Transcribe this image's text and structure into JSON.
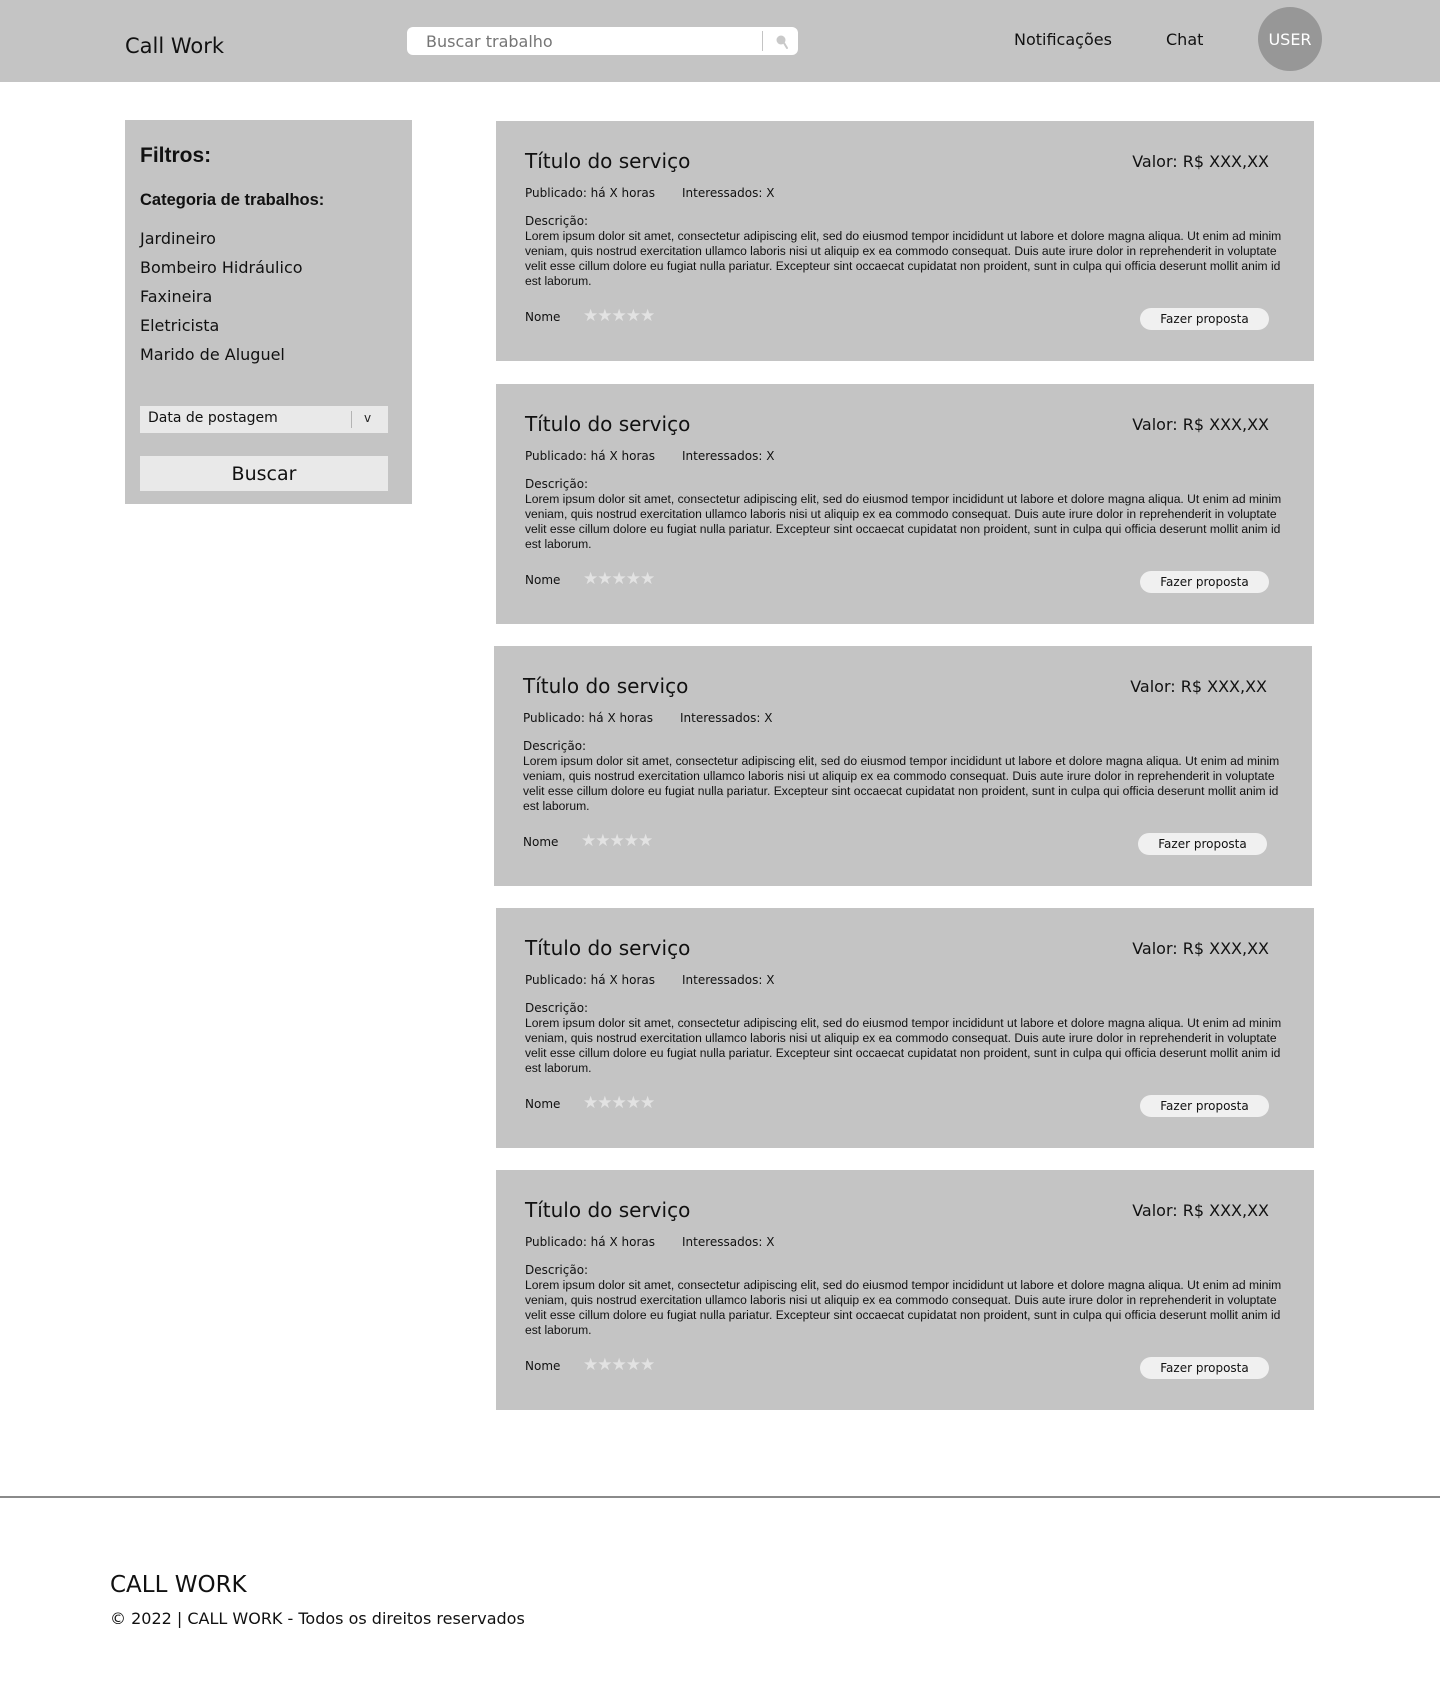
{
  "header": {
    "logo": "Call Work",
    "search_placeholder": "Buscar trabalho",
    "nav": {
      "notifications": "Notificações",
      "chat": "Chat"
    },
    "user_label": "USER"
  },
  "sidebar": {
    "title": "Filtros:",
    "category_title": "Categoria de trabalhos:",
    "categories": [
      "Jardineiro",
      "Bombeiro Hidráulico",
      "Faxineira",
      "Eletricista",
      "Marido de Aluguel"
    ],
    "sort_select": "Data de postagem",
    "sort_arrow": "v",
    "search_button": "Buscar"
  },
  "jobs": [
    {
      "title": "Título do serviço",
      "value": "Valor: R$ XXX,XX",
      "published": "Publicado: há X horas",
      "interested": "Interessados: X",
      "description_label": "Descrição:",
      "description": "Lorem ipsum dolor sit amet, consectetur adipiscing elit, sed do eiusmod tempor incididunt ut labore et dolore magna aliqua. Ut enim ad minim veniam, quis nostrud exercitation ullamco laboris nisi ut aliquip ex ea commodo consequat. Duis aute irure dolor in reprehenderit in voluptate velit esse cillum dolore eu fugiat nulla pariatur. Excepteur sint occaecat cupidatat non proident, sunt in culpa qui officia deserunt mollit anim id est laborum.",
      "name": "Nome",
      "stars": "★★★★★",
      "button": "Fazer proposta"
    },
    {
      "title": "Título do serviço",
      "value": "Valor: R$ XXX,XX",
      "published": "Publicado: há X horas",
      "interested": "Interessados: X",
      "description_label": "Descrição:",
      "description": "Lorem ipsum dolor sit amet, consectetur adipiscing elit, sed do eiusmod tempor incididunt ut labore et dolore magna aliqua. Ut enim ad minim veniam, quis nostrud exercitation ullamco laboris nisi ut aliquip ex ea commodo consequat. Duis aute irure dolor in reprehenderit in voluptate velit esse cillum dolore eu fugiat nulla pariatur. Excepteur sint occaecat cupidatat non proident, sunt in culpa qui officia deserunt mollit anim id est laborum.",
      "name": "Nome",
      "stars": "★★★★★",
      "button": "Fazer proposta"
    },
    {
      "title": "Título do serviço",
      "value": "Valor: R$ XXX,XX",
      "published": "Publicado: há X horas",
      "interested": "Interessados: X",
      "description_label": "Descrição:",
      "description": "Lorem ipsum dolor sit amet, consectetur adipiscing elit, sed do eiusmod tempor incididunt ut labore et dolore magna aliqua. Ut enim ad minim veniam, quis nostrud exercitation ullamco laboris nisi ut aliquip ex ea commodo consequat. Duis aute irure dolor in reprehenderit in voluptate velit esse cillum dolore eu fugiat nulla pariatur. Excepteur sint occaecat cupidatat non proident, sunt in culpa qui officia deserunt mollit anim id est laborum.",
      "name": "Nome",
      "stars": "★★★★★",
      "button": "Fazer proposta"
    },
    {
      "title": "Título do serviço",
      "value": "Valor: R$ XXX,XX",
      "published": "Publicado: há X horas",
      "interested": "Interessados: X",
      "description_label": "Descrição:",
      "description": "Lorem ipsum dolor sit amet, consectetur adipiscing elit, sed do eiusmod tempor incididunt ut labore et dolore magna aliqua. Ut enim ad minim veniam, quis nostrud exercitation ullamco laboris nisi ut aliquip ex ea commodo consequat. Duis aute irure dolor in reprehenderit in voluptate velit esse cillum dolore eu fugiat nulla pariatur. Excepteur sint occaecat cupidatat non proident, sunt in culpa qui officia deserunt mollit anim id est laborum.",
      "name": "Nome",
      "stars": "★★★★★",
      "button": "Fazer proposta"
    },
    {
      "title": "Título do serviço",
      "value": "Valor: R$ XXX,XX",
      "published": "Publicado: há X horas",
      "interested": "Interessados: X",
      "description_label": "Descrição:",
      "description": "Lorem ipsum dolor sit amet, consectetur adipiscing elit, sed do eiusmod tempor incididunt ut labore et dolore magna aliqua. Ut enim ad minim veniam, quis nostrud exercitation ullamco laboris nisi ut aliquip ex ea commodo consequat. Duis aute irure dolor in reprehenderit in voluptate velit esse cillum dolore eu fugiat nulla pariatur. Excepteur sint occaecat cupidatat non proident, sunt in culpa qui officia deserunt mollit anim id est laborum.",
      "name": "Nome",
      "stars": "★★★★★",
      "button": "Fazer proposta"
    }
  ],
  "footer": {
    "brand": "CALL WORK",
    "copyright": "© 2022 | CALL WORK - Todos os direitos reservados"
  }
}
